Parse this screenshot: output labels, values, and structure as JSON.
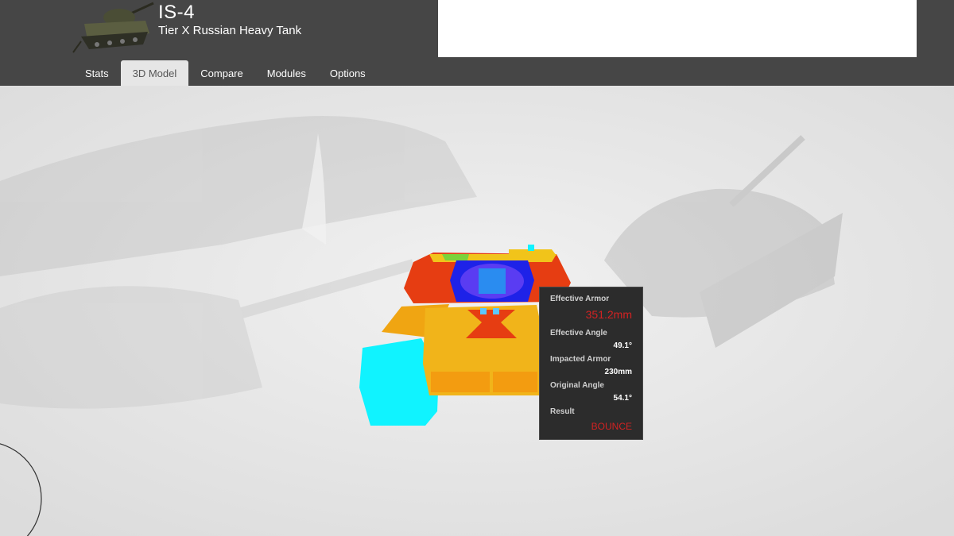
{
  "header": {
    "tank_name": "IS-4",
    "tank_subtitle": "Tier X Russian Heavy Tank",
    "thumbnail_icon": "tank-thumbnail-icon"
  },
  "tabs": [
    {
      "label": "Stats",
      "active": false
    },
    {
      "label": "3D Model",
      "active": true
    },
    {
      "label": "Compare",
      "active": false
    },
    {
      "label": "Modules",
      "active": false
    },
    {
      "label": "Options",
      "active": false
    }
  ],
  "tooltip": {
    "effective_armor_label": "Effective Armor",
    "effective_armor_value": "351.2mm",
    "effective_angle_label": "Effective Angle",
    "effective_angle_value": "49.1°",
    "impacted_armor_label": "Impacted Armor",
    "impacted_armor_value": "230mm",
    "original_angle_label": "Original Angle",
    "original_angle_value": "54.1°",
    "result_label": "Result",
    "result_value": "BOUNCE"
  },
  "colors": {
    "header_bg": "#464646",
    "result_red": "#d32222",
    "armor_orange": "#f1b41a",
    "armor_red": "#e63d12",
    "armor_blue": "#1e22e8",
    "armor_cyan": "#10f3ff"
  }
}
